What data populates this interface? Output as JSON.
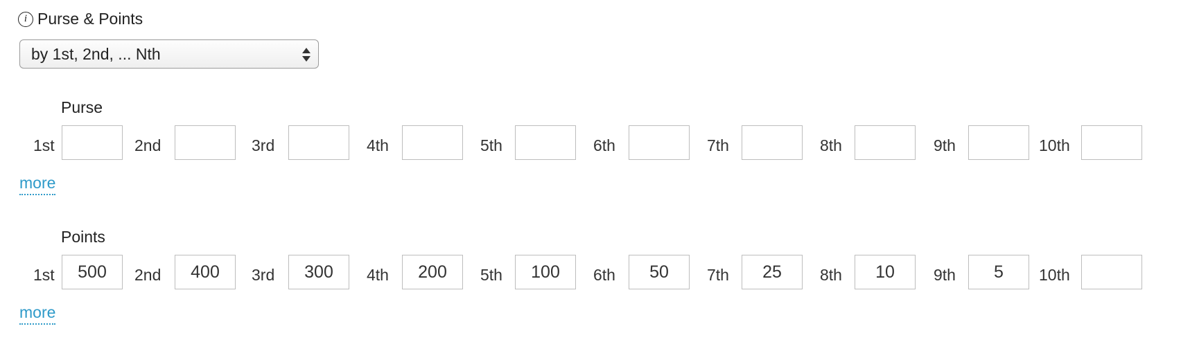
{
  "header": {
    "title": "Purse & Points",
    "info_icon_glyph": "i"
  },
  "select": {
    "value": "by 1st, 2nd, ... Nth"
  },
  "purse": {
    "label": "Purse",
    "places": [
      {
        "label": "1st",
        "value": ""
      },
      {
        "label": "2nd",
        "value": ""
      },
      {
        "label": "3rd",
        "value": ""
      },
      {
        "label": "4th",
        "value": ""
      },
      {
        "label": "5th",
        "value": ""
      },
      {
        "label": "6th",
        "value": ""
      },
      {
        "label": "7th",
        "value": ""
      },
      {
        "label": "8th",
        "value": ""
      },
      {
        "label": "9th",
        "value": ""
      },
      {
        "label": "10th",
        "value": ""
      }
    ],
    "more_label": "more"
  },
  "points": {
    "label": "Points",
    "places": [
      {
        "label": "1st",
        "value": "500"
      },
      {
        "label": "2nd",
        "value": "400"
      },
      {
        "label": "3rd",
        "value": "300"
      },
      {
        "label": "4th",
        "value": "200"
      },
      {
        "label": "5th",
        "value": "100"
      },
      {
        "label": "6th",
        "value": "50"
      },
      {
        "label": "7th",
        "value": "25"
      },
      {
        "label": "8th",
        "value": "10"
      },
      {
        "label": "9th",
        "value": "5"
      },
      {
        "label": "10th",
        "value": ""
      }
    ],
    "more_label": "more"
  }
}
